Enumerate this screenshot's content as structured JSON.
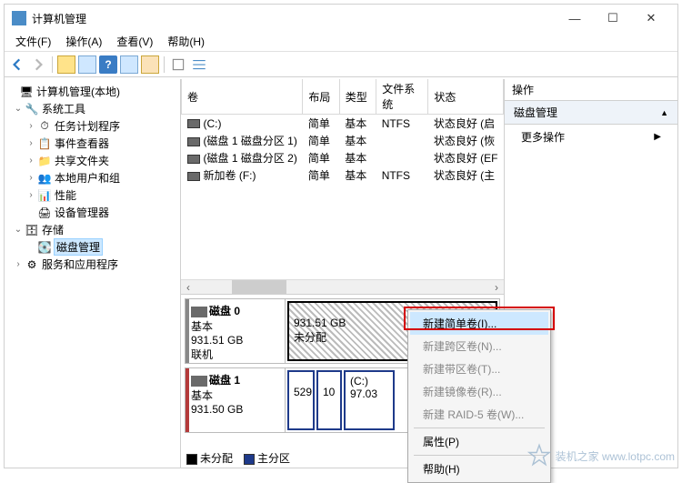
{
  "window": {
    "title": "计算机管理",
    "min": "—",
    "max": "☐",
    "close": "✕"
  },
  "menu": {
    "file": "文件(F)",
    "action": "操作(A)",
    "view": "查看(V)",
    "help": "帮助(H)"
  },
  "tree": {
    "root": "计算机管理(本地)",
    "sys": "系统工具",
    "sched": "任务计划程序",
    "event": "事件查看器",
    "shared": "共享文件夹",
    "users": "本地用户和组",
    "perf": "性能",
    "devmgr": "设备管理器",
    "storage": "存储",
    "diskmgmt": "磁盘管理",
    "services": "服务和应用程序"
  },
  "cols": {
    "vol": "卷",
    "layout": "布局",
    "type": "类型",
    "fs": "文件系统",
    "status": "状态"
  },
  "vols": [
    {
      "name": "(C:)",
      "layout": "简单",
      "type": "基本",
      "fs": "NTFS",
      "status": "状态良好 (启"
    },
    {
      "name": "(磁盘 1 磁盘分区 1)",
      "layout": "简单",
      "type": "基本",
      "fs": "",
      "status": "状态良好 (恢"
    },
    {
      "name": "(磁盘 1 磁盘分区 2)",
      "layout": "简单",
      "type": "基本",
      "fs": "",
      "status": "状态良好 (EF"
    },
    {
      "name": "新加卷 (F:)",
      "layout": "简单",
      "type": "基本",
      "fs": "NTFS",
      "status": "状态良好 (主"
    }
  ],
  "disk0": {
    "name": "磁盘 0",
    "type": "基本",
    "size": "931.51 GB",
    "status": "联机",
    "part": {
      "size": "931.51 GB",
      "state": "未分配"
    }
  },
  "disk1": {
    "name": "磁盘 1",
    "type": "基本",
    "size": "931.50 GB",
    "p1": "529",
    "p2": "10",
    "p3": {
      "name": "(C:)",
      "size": "97.03"
    }
  },
  "legend": {
    "unalloc": "未分配",
    "primary": "主分区"
  },
  "actions": {
    "hdr": "操作",
    "sec": "磁盘管理",
    "more": "更多操作"
  },
  "ctx": {
    "simple": "新建简单卷(I)...",
    "span": "新建跨区卷(N)...",
    "stripe": "新建带区卷(T)...",
    "mirror": "新建镜像卷(R)...",
    "raid5": "新建 RAID-5 卷(W)...",
    "prop": "属性(P)",
    "help": "帮助(H)"
  },
  "wm": "装机之家  www.lotpc.com"
}
